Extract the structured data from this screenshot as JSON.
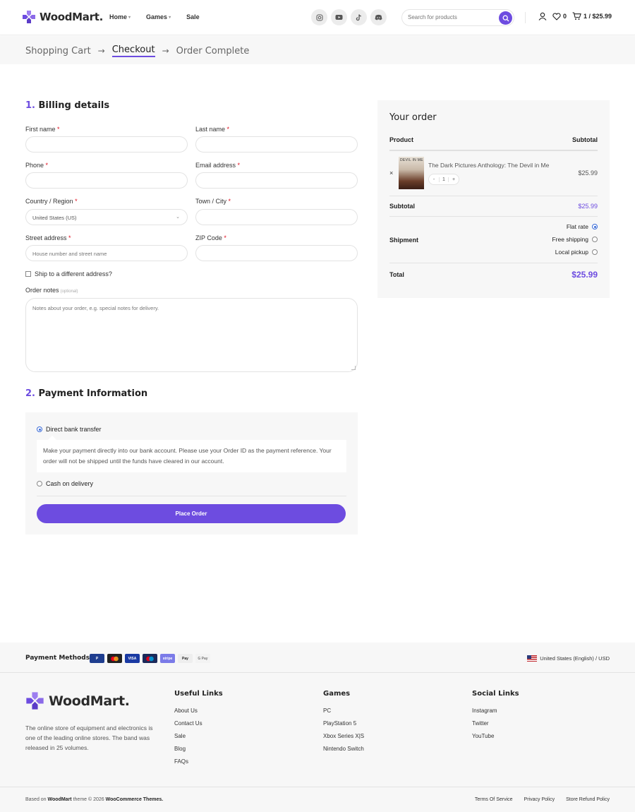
{
  "header": {
    "brand": "WoodMart.",
    "nav": [
      {
        "label": "Home",
        "has_caret": true
      },
      {
        "label": "Games",
        "has_caret": true
      },
      {
        "label": "Sale",
        "has_caret": false
      }
    ],
    "socials": [
      "instagram-icon",
      "youtube-icon",
      "tiktok-icon",
      "discord-icon"
    ],
    "search_placeholder": "Search for products",
    "wishlist_count": "0",
    "cart_summary": "1 / $25.99"
  },
  "steps": {
    "cart": "Shopping Cart",
    "checkout": "Checkout",
    "complete": "Order Complete"
  },
  "billing": {
    "number": "1.",
    "title": "Billing details",
    "first_name": "First name",
    "last_name": "Last name",
    "phone": "Phone",
    "email": "Email address",
    "country": "Country / Region",
    "country_value": "United States (US)",
    "town": "Town / City",
    "street": "Street address",
    "street_placeholder": "House number and street name",
    "zip": "ZIP Code",
    "required_mark": "*",
    "ship_different": "Ship to a different address?",
    "order_notes": "Order notes",
    "optional": "(optional)",
    "notes_placeholder": "Notes about your order, e.g. special notes for delivery."
  },
  "payment": {
    "number": "2.",
    "title": "Payment Information",
    "bank_transfer": "Direct bank transfer",
    "bank_desc": "Make your payment directly into our bank account. Please use your Order ID as the payment reference. Your order will not be shipped until the funds have cleared in our account.",
    "cod": "Cash on delivery",
    "place_order": "Place Order"
  },
  "order": {
    "title": "Your order",
    "col_product": "Product",
    "col_subtotal": "Subtotal",
    "product_name": "The Dark Pictures Anthology: The Devil in Me",
    "thumb_label": "DEVIL IN ME",
    "qty_minus": "-",
    "qty": "1",
    "qty_plus": "+",
    "remove": "×",
    "product_price": "$25.99",
    "subtotal_label": "Subtotal",
    "subtotal_value": "$25.99",
    "shipment_label": "Shipment",
    "shipping_options": [
      {
        "label": "Flat rate",
        "selected": true
      },
      {
        "label": "Free shipping",
        "selected": false
      },
      {
        "label": "Local pickup",
        "selected": false
      }
    ],
    "total_label": "Total",
    "total_value": "$25.99"
  },
  "footer": {
    "payment_methods_label": "Payment Methods:",
    "payment_methods": [
      {
        "name": "paypal-icon",
        "label": "P",
        "color": "#1f3e8f"
      },
      {
        "name": "mastercard-icon",
        "label": "",
        "color": "#222222"
      },
      {
        "name": "visa-icon",
        "label": "VISA",
        "color": "#1a3aa3"
      },
      {
        "name": "maestro-icon",
        "label": "",
        "color": "#1c2a5a"
      },
      {
        "name": "stripe-icon",
        "label": "stripe",
        "color": "#7b7be8"
      },
      {
        "name": "apple-pay-icon",
        "label": "Pay",
        "color": "#eeeeee"
      },
      {
        "name": "google-pay-icon",
        "label": "G Pay",
        "color": "#f3f3f3"
      }
    ],
    "locale": "United States (English) / USD",
    "brand": "WoodMart.",
    "description": "The online store of equipment and electronics is one of the leading online stores. The band was released in 25 volumes.",
    "columns": [
      {
        "title": "Useful Links",
        "links": [
          "About Us",
          "Contact Us",
          "Sale",
          "Blog",
          "FAQs"
        ]
      },
      {
        "title": "Games",
        "links": [
          "PC",
          "PlayStation 5",
          "Xbox Series X|S",
          "Nintendo Switch"
        ]
      },
      {
        "title": "Social Links",
        "links": [
          "Instagram",
          "Twitter",
          "YouTube"
        ]
      }
    ],
    "copyright_prefix": "Based on",
    "copyright_brand": "WoodMart",
    "copyright_mid": "theme © 2026",
    "copyright_themes": "WooCommerce Themes.",
    "legal": [
      "Terms Of Service",
      "Privacy Policy",
      "Store Refund Policy"
    ]
  },
  "colors": {
    "accent": "#6d4ce0",
    "required": "#e01020",
    "band": "#f7f7f7"
  }
}
